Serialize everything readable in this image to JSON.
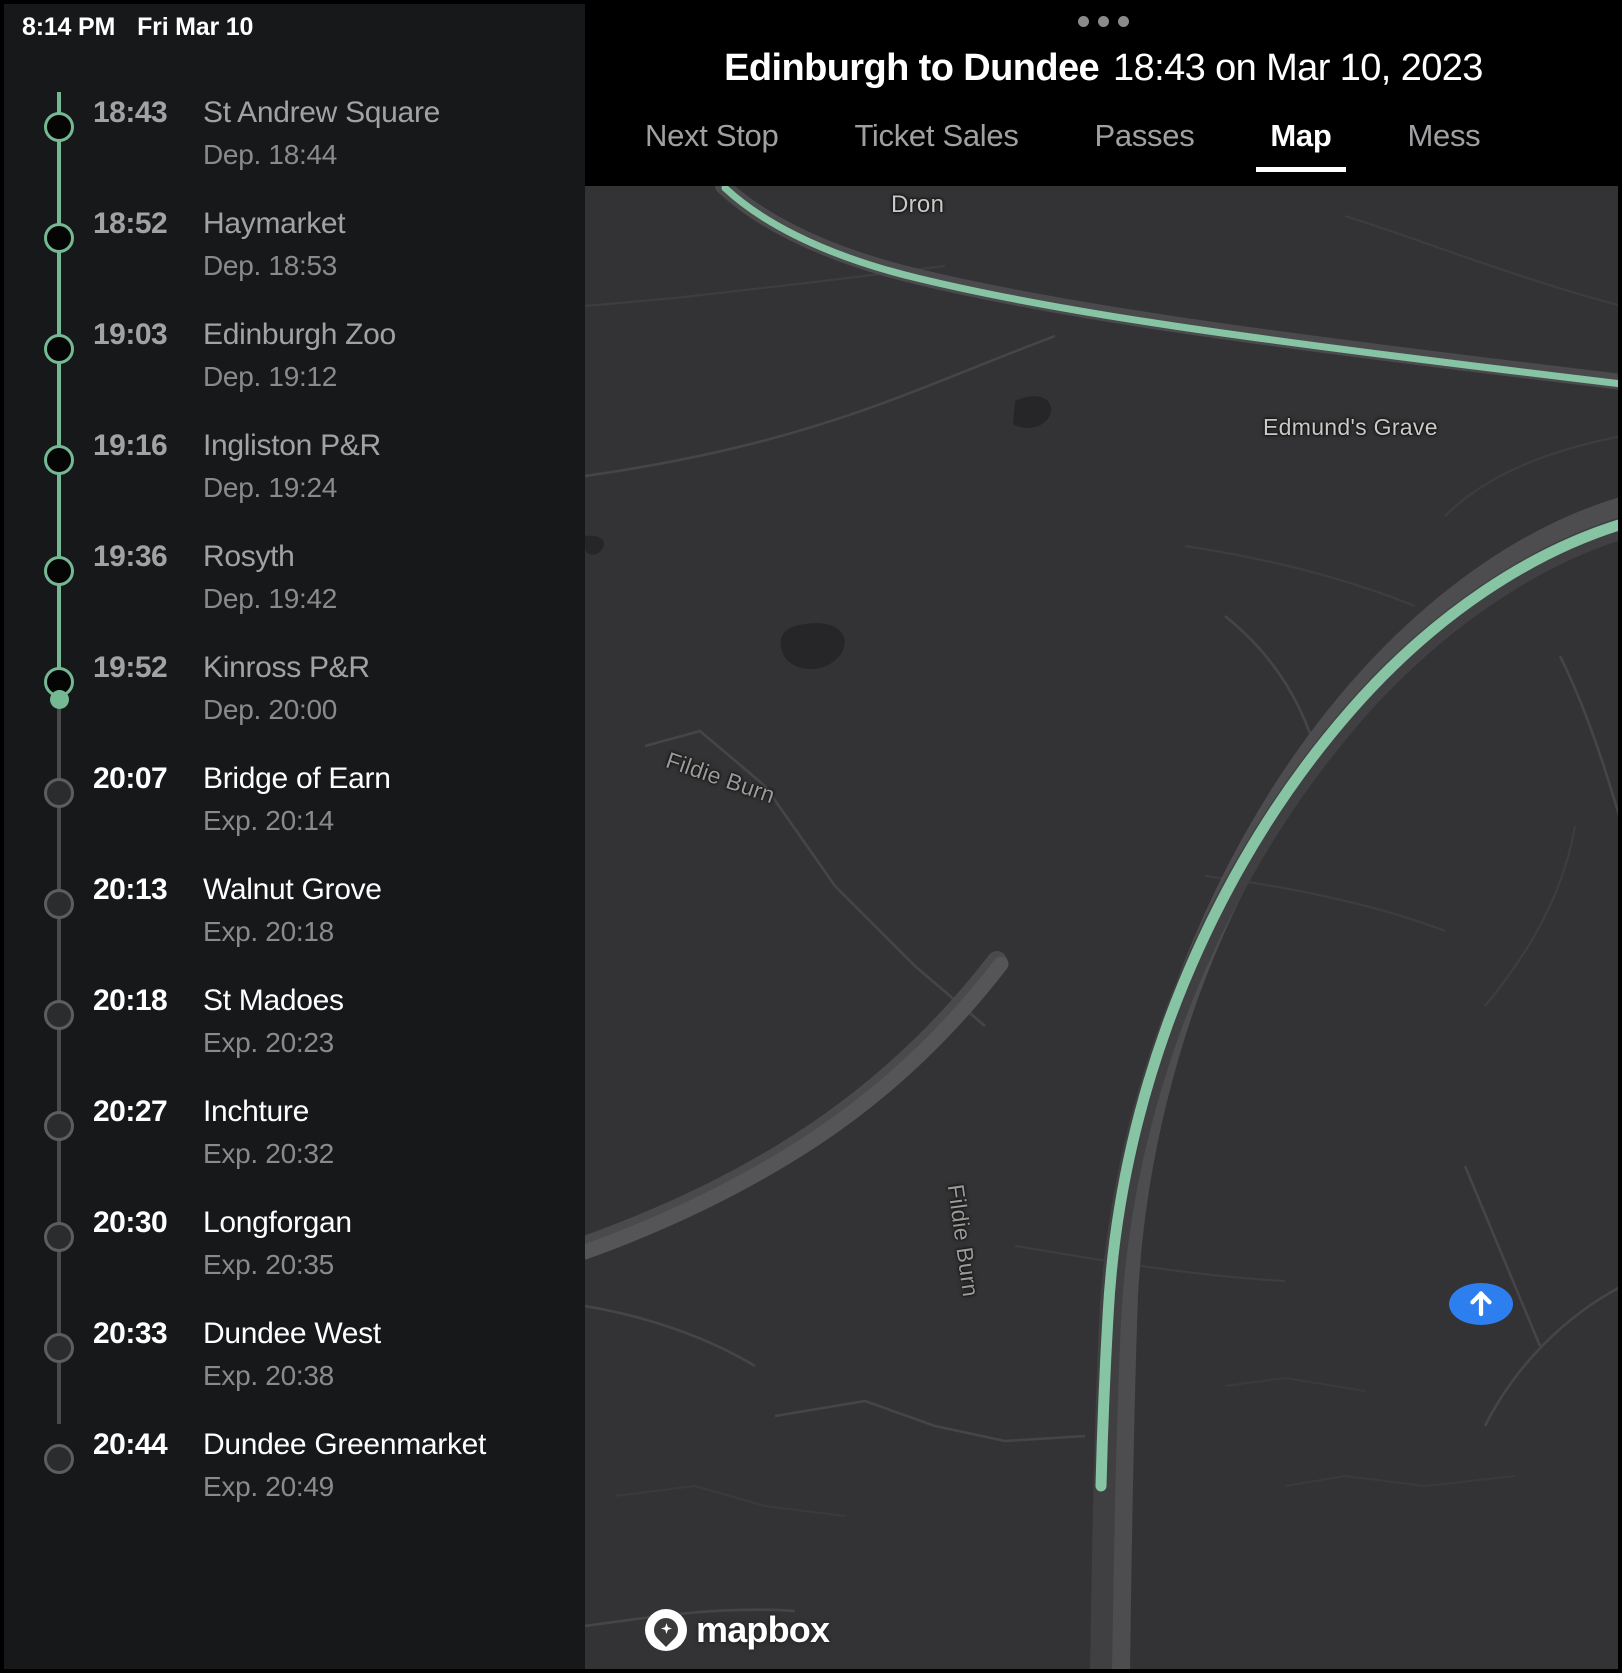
{
  "status_bar": {
    "time": "8:14 PM",
    "date": "Fri Mar 10"
  },
  "trip": {
    "route_title": "Edinburgh to Dundee",
    "departure_label": "18:43 on Mar 10, 2023"
  },
  "tabs": [
    {
      "label": "Next Stop",
      "active": false
    },
    {
      "label": "Ticket Sales",
      "active": false
    },
    {
      "label": "Passes",
      "active": false
    },
    {
      "label": "Map",
      "active": true
    },
    {
      "label": "Mess",
      "active": false
    }
  ],
  "stops": [
    {
      "time": "18:43",
      "name": "St Andrew Square",
      "sub": "Dep. 18:44",
      "state": "past"
    },
    {
      "time": "18:52",
      "name": "Haymarket",
      "sub": "Dep. 18:53",
      "state": "past"
    },
    {
      "time": "19:03",
      "name": "Edinburgh Zoo",
      "sub": "Dep. 19:12",
      "state": "past"
    },
    {
      "time": "19:16",
      "name": "Ingliston P&R",
      "sub": "Dep. 19:24",
      "state": "past"
    },
    {
      "time": "19:36",
      "name": "Rosyth",
      "sub": "Dep. 19:42",
      "state": "past"
    },
    {
      "time": "19:52",
      "name": "Kinross P&R",
      "sub": "Dep. 20:00",
      "state": "past"
    },
    {
      "time": "20:07",
      "name": "Bridge of Earn",
      "sub": "Exp. 20:14",
      "state": "future"
    },
    {
      "time": "20:13",
      "name": "Walnut Grove",
      "sub": "Exp. 20:18",
      "state": "future"
    },
    {
      "time": "20:18",
      "name": "St Madoes",
      "sub": "Exp. 20:23",
      "state": "future"
    },
    {
      "time": "20:27",
      "name": "Inchture",
      "sub": "Exp. 20:32",
      "state": "future"
    },
    {
      "time": "20:30",
      "name": "Longforgan",
      "sub": "Exp. 20:35",
      "state": "future"
    },
    {
      "time": "20:33",
      "name": "Dundee West",
      "sub": "Exp. 20:38",
      "state": "future"
    },
    {
      "time": "20:44",
      "name": "Dundee Greenmarket",
      "sub": "Exp. 20:49",
      "state": "future"
    }
  ],
  "map": {
    "labels": {
      "dron": "Dron",
      "edmunds_grave": "Edmund's Grave",
      "fildie_burn_1": "Fildie Burn",
      "fildie_burn_2": "Fildie Burn"
    },
    "attribution": "mapbox",
    "vehicle_marker_icon": "arrow-up-icon"
  },
  "colors": {
    "route_green": "#74b894",
    "vehicle_blue": "#2d7ff0",
    "map_background": "#333335",
    "sidebar_background": "#17181a",
    "header_background": "#000000",
    "future_text": "#ffffff",
    "past_text": "#a2a2a4",
    "secondary_text": "#8a8a8c"
  }
}
